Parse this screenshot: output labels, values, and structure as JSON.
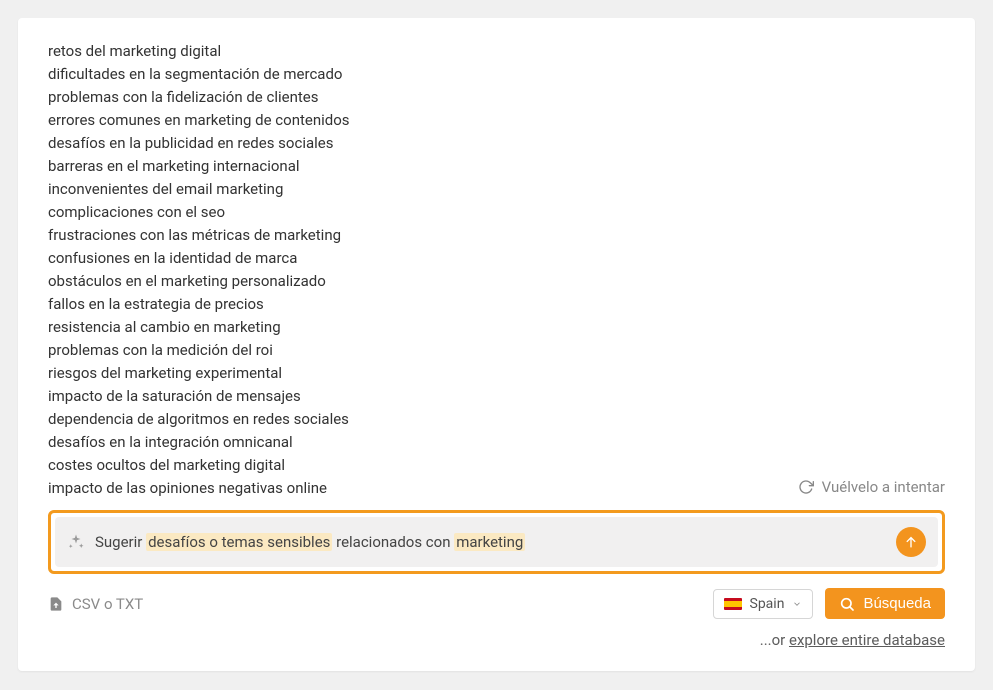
{
  "results": [
    "retos del marketing digital",
    "dificultades en la segmentación de mercado",
    "problemas con la fidelización de clientes",
    "errores comunes en marketing de contenidos",
    "desafíos en la publicidad en redes sociales",
    "barreras en el marketing internacional",
    "inconvenientes del email marketing",
    "complicaciones con el seo",
    "frustraciones con las métricas de marketing",
    "confusiones en la identidad de marca",
    "obstáculos en el marketing personalizado",
    "fallos en la estrategia de precios",
    "resistencia al cambio en marketing",
    "problemas con la medición del roi",
    "riesgos del marketing experimental",
    "impacto de la saturación de mensajes",
    "dependencia de algoritmos en redes sociales",
    "desafíos en la integración omnicanal",
    "costes ocultos del marketing digital",
    "impacto de las opiniones negativas online"
  ],
  "retry_label": "Vuélvelo a intentar",
  "suggest": {
    "prefix": "Sugerir ",
    "highlight1": "desafíos o temas sensibles",
    "middle": " relacionados con ",
    "highlight2": "marketing"
  },
  "upload_label": "CSV o TXT",
  "country": {
    "label": "Spain"
  },
  "search_label": "Búsqueda",
  "explore_prefix": "...or ",
  "explore_link": "explore entire database"
}
